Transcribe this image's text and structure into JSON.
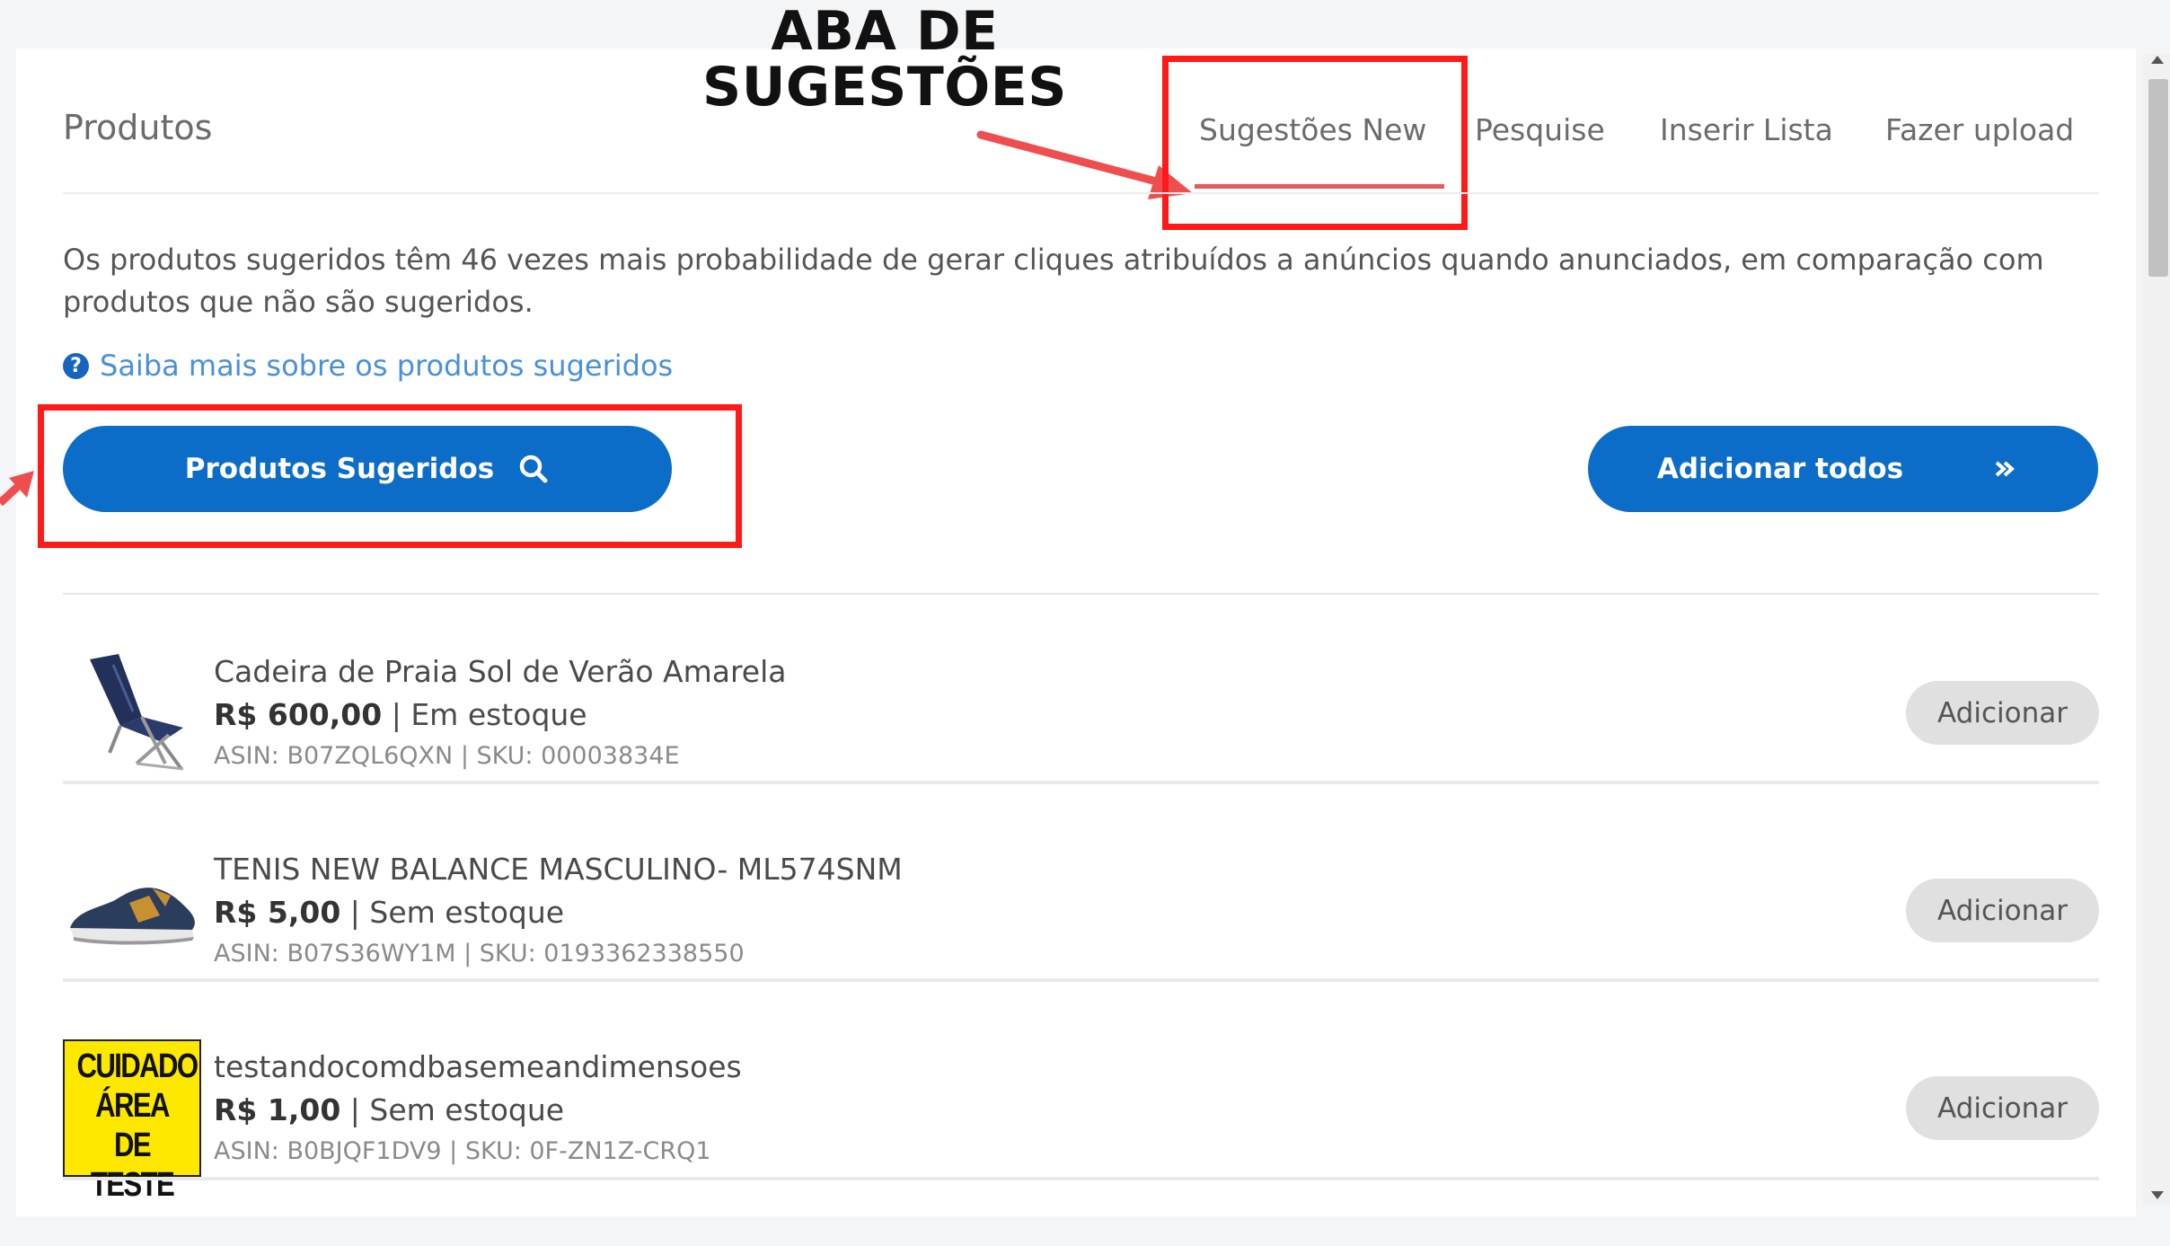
{
  "annotation": {
    "title_line1": "ABA DE",
    "title_line2": "SUGESTÕES",
    "color": "#ff1a1a"
  },
  "header": {
    "title": "Produtos"
  },
  "tabs": [
    {
      "label": "Sugestões New",
      "active": true
    },
    {
      "label": "Pesquise",
      "active": false
    },
    {
      "label": "Inserir Lista",
      "active": false
    },
    {
      "label": "Fazer upload",
      "active": false
    }
  ],
  "description": "Os produtos sugeridos têm 46 vezes mais probabilidade de gerar cliques atribuídos a anúncios quando anunciados, em comparação com produtos que não são sugeridos.",
  "help_link": {
    "label": "Saiba mais sobre os produtos sugeridos",
    "icon": "question-circle-icon"
  },
  "actions": {
    "suggested_label": "Produtos Sugeridos",
    "suggested_icon": "search-icon",
    "add_all_label": "Adicionar todos",
    "add_all_icon": "double-chevron-right-icon",
    "accent": "#0b6dc7"
  },
  "products": [
    {
      "name": "Cadeira de Praia Sol de Verão Amarela",
      "price": "R$ 600,00",
      "stock": "Em estoque",
      "meta": "ASIN: B07ZQL6QXN | SKU: 00003834E",
      "add_label": "Adicionar",
      "image": "beach-chair-image"
    },
    {
      "name": "TENIS NEW BALANCE MASCULINO- ML574SNM",
      "price": "R$ 5,00",
      "stock": "Sem estoque",
      "meta": "ASIN: B07S36WY1M | SKU: 0193362338550",
      "add_label": "Adicionar",
      "image": "sneaker-image"
    },
    {
      "name": "testandocomdbasemeandimensoes",
      "price": "R$ 1,00",
      "stock": "Sem estoque",
      "meta": "ASIN: B0BJQF1DV9 | SKU: 0F-ZN1Z-CRQ1",
      "add_label": "Adicionar",
      "image": "warning-sign-image",
      "image_text": [
        "CUIDADO",
        "ÁREA DE",
        "TESTE"
      ]
    }
  ]
}
